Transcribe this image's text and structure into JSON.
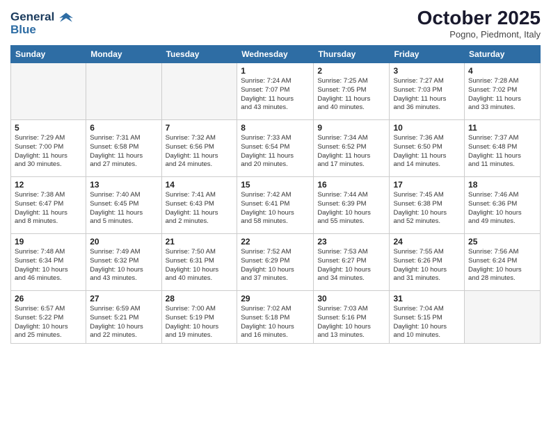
{
  "header": {
    "logo_line1": "General",
    "logo_line2": "Blue",
    "month": "October 2025",
    "location": "Pogno, Piedmont, Italy"
  },
  "weekdays": [
    "Sunday",
    "Monday",
    "Tuesday",
    "Wednesday",
    "Thursday",
    "Friday",
    "Saturday"
  ],
  "weeks": [
    [
      {
        "day": "",
        "info": ""
      },
      {
        "day": "",
        "info": ""
      },
      {
        "day": "",
        "info": ""
      },
      {
        "day": "1",
        "info": "Sunrise: 7:24 AM\nSunset: 7:07 PM\nDaylight: 11 hours\nand 43 minutes."
      },
      {
        "day": "2",
        "info": "Sunrise: 7:25 AM\nSunset: 7:05 PM\nDaylight: 11 hours\nand 40 minutes."
      },
      {
        "day": "3",
        "info": "Sunrise: 7:27 AM\nSunset: 7:03 PM\nDaylight: 11 hours\nand 36 minutes."
      },
      {
        "day": "4",
        "info": "Sunrise: 7:28 AM\nSunset: 7:02 PM\nDaylight: 11 hours\nand 33 minutes."
      }
    ],
    [
      {
        "day": "5",
        "info": "Sunrise: 7:29 AM\nSunset: 7:00 PM\nDaylight: 11 hours\nand 30 minutes."
      },
      {
        "day": "6",
        "info": "Sunrise: 7:31 AM\nSunset: 6:58 PM\nDaylight: 11 hours\nand 27 minutes."
      },
      {
        "day": "7",
        "info": "Sunrise: 7:32 AM\nSunset: 6:56 PM\nDaylight: 11 hours\nand 24 minutes."
      },
      {
        "day": "8",
        "info": "Sunrise: 7:33 AM\nSunset: 6:54 PM\nDaylight: 11 hours\nand 20 minutes."
      },
      {
        "day": "9",
        "info": "Sunrise: 7:34 AM\nSunset: 6:52 PM\nDaylight: 11 hours\nand 17 minutes."
      },
      {
        "day": "10",
        "info": "Sunrise: 7:36 AM\nSunset: 6:50 PM\nDaylight: 11 hours\nand 14 minutes."
      },
      {
        "day": "11",
        "info": "Sunrise: 7:37 AM\nSunset: 6:48 PM\nDaylight: 11 hours\nand 11 minutes."
      }
    ],
    [
      {
        "day": "12",
        "info": "Sunrise: 7:38 AM\nSunset: 6:47 PM\nDaylight: 11 hours\nand 8 minutes."
      },
      {
        "day": "13",
        "info": "Sunrise: 7:40 AM\nSunset: 6:45 PM\nDaylight: 11 hours\nand 5 minutes."
      },
      {
        "day": "14",
        "info": "Sunrise: 7:41 AM\nSunset: 6:43 PM\nDaylight: 11 hours\nand 2 minutes."
      },
      {
        "day": "15",
        "info": "Sunrise: 7:42 AM\nSunset: 6:41 PM\nDaylight: 10 hours\nand 58 minutes."
      },
      {
        "day": "16",
        "info": "Sunrise: 7:44 AM\nSunset: 6:39 PM\nDaylight: 10 hours\nand 55 minutes."
      },
      {
        "day": "17",
        "info": "Sunrise: 7:45 AM\nSunset: 6:38 PM\nDaylight: 10 hours\nand 52 minutes."
      },
      {
        "day": "18",
        "info": "Sunrise: 7:46 AM\nSunset: 6:36 PM\nDaylight: 10 hours\nand 49 minutes."
      }
    ],
    [
      {
        "day": "19",
        "info": "Sunrise: 7:48 AM\nSunset: 6:34 PM\nDaylight: 10 hours\nand 46 minutes."
      },
      {
        "day": "20",
        "info": "Sunrise: 7:49 AM\nSunset: 6:32 PM\nDaylight: 10 hours\nand 43 minutes."
      },
      {
        "day": "21",
        "info": "Sunrise: 7:50 AM\nSunset: 6:31 PM\nDaylight: 10 hours\nand 40 minutes."
      },
      {
        "day": "22",
        "info": "Sunrise: 7:52 AM\nSunset: 6:29 PM\nDaylight: 10 hours\nand 37 minutes."
      },
      {
        "day": "23",
        "info": "Sunrise: 7:53 AM\nSunset: 6:27 PM\nDaylight: 10 hours\nand 34 minutes."
      },
      {
        "day": "24",
        "info": "Sunrise: 7:55 AM\nSunset: 6:26 PM\nDaylight: 10 hours\nand 31 minutes."
      },
      {
        "day": "25",
        "info": "Sunrise: 7:56 AM\nSunset: 6:24 PM\nDaylight: 10 hours\nand 28 minutes."
      }
    ],
    [
      {
        "day": "26",
        "info": "Sunrise: 6:57 AM\nSunset: 5:22 PM\nDaylight: 10 hours\nand 25 minutes."
      },
      {
        "day": "27",
        "info": "Sunrise: 6:59 AM\nSunset: 5:21 PM\nDaylight: 10 hours\nand 22 minutes."
      },
      {
        "day": "28",
        "info": "Sunrise: 7:00 AM\nSunset: 5:19 PM\nDaylight: 10 hours\nand 19 minutes."
      },
      {
        "day": "29",
        "info": "Sunrise: 7:02 AM\nSunset: 5:18 PM\nDaylight: 10 hours\nand 16 minutes."
      },
      {
        "day": "30",
        "info": "Sunrise: 7:03 AM\nSunset: 5:16 PM\nDaylight: 10 hours\nand 13 minutes."
      },
      {
        "day": "31",
        "info": "Sunrise: 7:04 AM\nSunset: 5:15 PM\nDaylight: 10 hours\nand 10 minutes."
      },
      {
        "day": "",
        "info": ""
      }
    ]
  ]
}
